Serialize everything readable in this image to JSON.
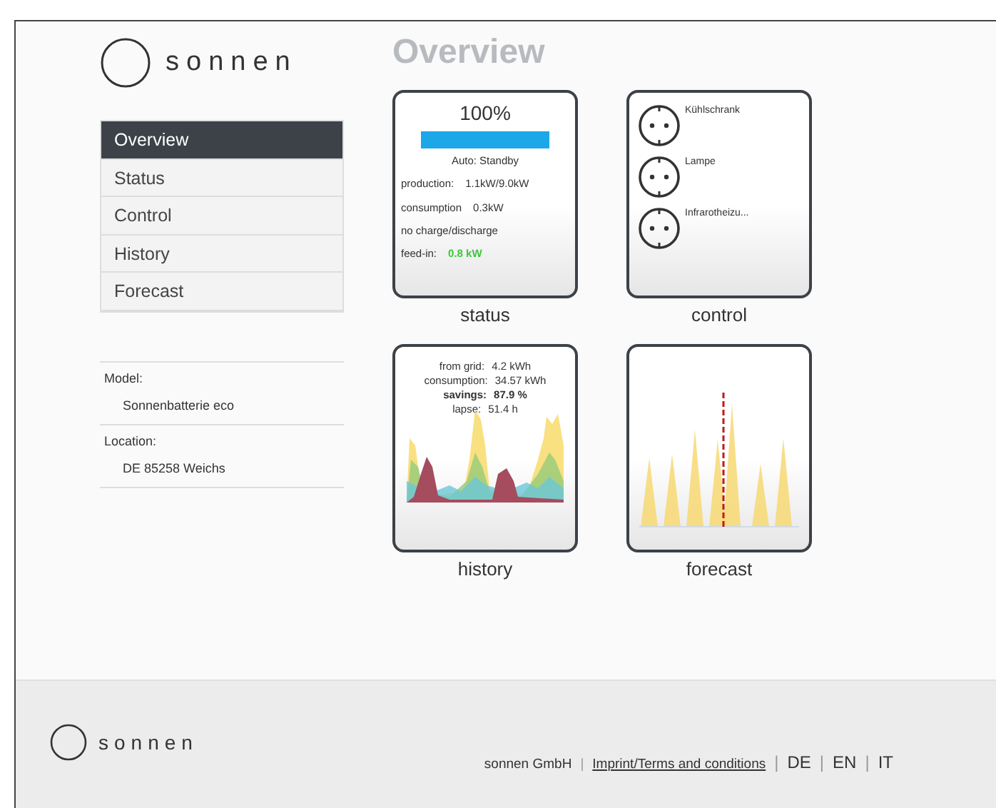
{
  "brand": {
    "name": "sonnen"
  },
  "page_title": "Overview",
  "nav": [
    {
      "label": "Overview",
      "selected": true
    },
    {
      "label": "Status",
      "selected": false
    },
    {
      "label": "Control",
      "selected": false
    },
    {
      "label": "History",
      "selected": false
    },
    {
      "label": "Forecast",
      "selected": false
    }
  ],
  "info": [
    {
      "label": "Model:",
      "value": "Sonnenbatterie eco"
    },
    {
      "label": "Location:",
      "value": "DE 85258 Weichs"
    }
  ],
  "status_tile": {
    "percent": "100%",
    "level": 1.0,
    "mode": "Auto: Standby",
    "rows": [
      {
        "label": "production:",
        "value": "1.1kW/9.0kW"
      },
      {
        "label": "consumption",
        "value": "0.3kW"
      },
      {
        "label": "no charge/discharge"
      },
      {
        "label": "feed-in:",
        "value": "0.8 kW",
        "color": "#3cc83c"
      }
    ],
    "caption": "status"
  },
  "control_tile": {
    "outlets": [
      {
        "name": "Kühlschrank"
      },
      {
        "name": "Lampe"
      },
      {
        "name": "Infrarotheizu..."
      }
    ],
    "caption": "control"
  },
  "history_tile": {
    "stats": [
      {
        "label": "from grid:",
        "value": "4.2 kWh",
        "emphasis": false
      },
      {
        "label": "consumption:",
        "value": "34.57 kWh",
        "emphasis": false
      },
      {
        "label": "savings:",
        "value": "87.9 %",
        "emphasis": true
      },
      {
        "label": "lapse:",
        "value": "51.4 h",
        "emphasis": false
      }
    ],
    "caption": "history"
  },
  "forecast_tile": {
    "caption": "forecast"
  },
  "footer": {
    "brand": "sonnen",
    "company": "sonnen GmbH",
    "separator": "|",
    "link": "Imprint/Terms and conditions",
    "languages": [
      "DE",
      "EN",
      "IT"
    ]
  }
}
